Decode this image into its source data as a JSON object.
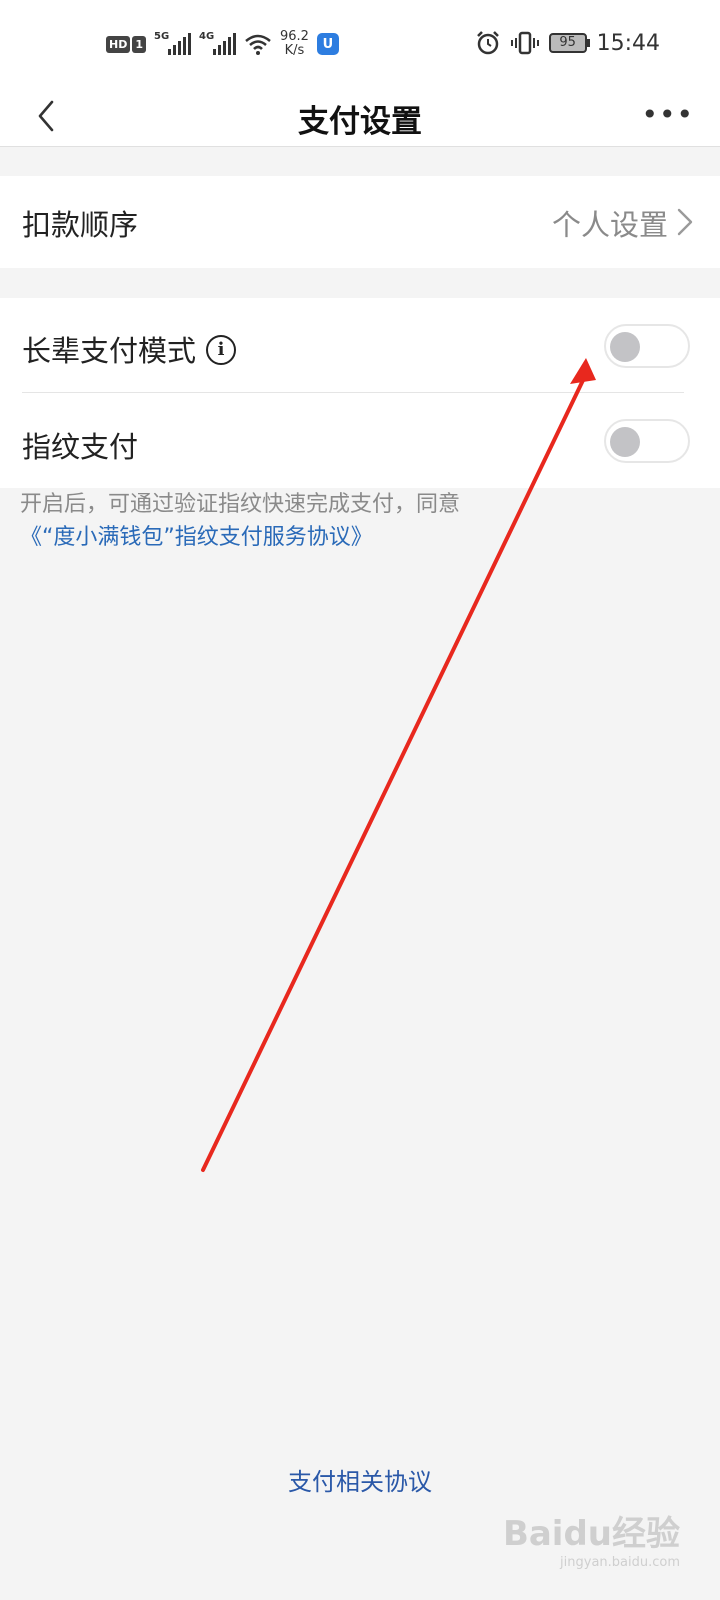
{
  "status_bar": {
    "hd": "HD",
    "sim": "1",
    "net1": "5G",
    "net2": "4G",
    "speed_value": "96.2",
    "speed_unit": "K/s",
    "app_icon_letter": "U",
    "battery": "95",
    "time": "15:44"
  },
  "header": {
    "title": "支付设置"
  },
  "deduction_order": {
    "label": "扣款顺序",
    "value": "个人设置"
  },
  "elder_mode": {
    "label": "长辈支付模式",
    "info_glyph": "i",
    "enabled": false
  },
  "fingerprint": {
    "label": "指纹支付",
    "enabled": false
  },
  "note": {
    "text": "开启后，可通过验证指纹快速完成支付，同意",
    "link": "《“度小满钱包”指纹支付服务协议》"
  },
  "footer": {
    "link": "支付相关协议"
  },
  "watermark": {
    "brand": "Baidu经验",
    "url": "jingyan.baidu.com"
  },
  "colors": {
    "accent_link": "#2a6ab8",
    "annotation_arrow": "#e8281e"
  }
}
